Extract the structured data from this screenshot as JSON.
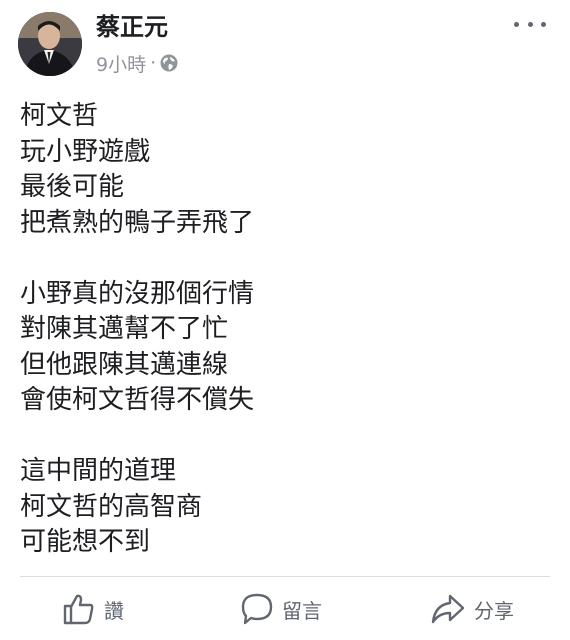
{
  "post": {
    "author": "蔡正元",
    "time": "9小時",
    "meta_separator": "·",
    "privacy_icon": "globe-icon",
    "more_icon": "more-dots-icon",
    "paragraphs": [
      [
        "柯文哲",
        "玩小野遊戲",
        "最後可能",
        "把煮熟的鴨子弄飛了"
      ],
      [
        "小野真的沒那個行情",
        "對陳其邁幫不了忙",
        "但他跟陳其邁連線",
        "會使柯文哲得不償失"
      ],
      [
        "這中間的道理",
        "柯文哲的高智商",
        "可能想不到"
      ]
    ]
  },
  "actions": {
    "like": {
      "label": "讚",
      "icon": "thumbs-up-icon"
    },
    "comment": {
      "label": "留言",
      "icon": "comment-bubble-icon"
    },
    "share": {
      "label": "分享",
      "icon": "share-arrow-icon"
    }
  },
  "colors": {
    "text": "#1c1e21",
    "meta": "#90949c",
    "action": "#606770",
    "divider": "#dadde1"
  }
}
